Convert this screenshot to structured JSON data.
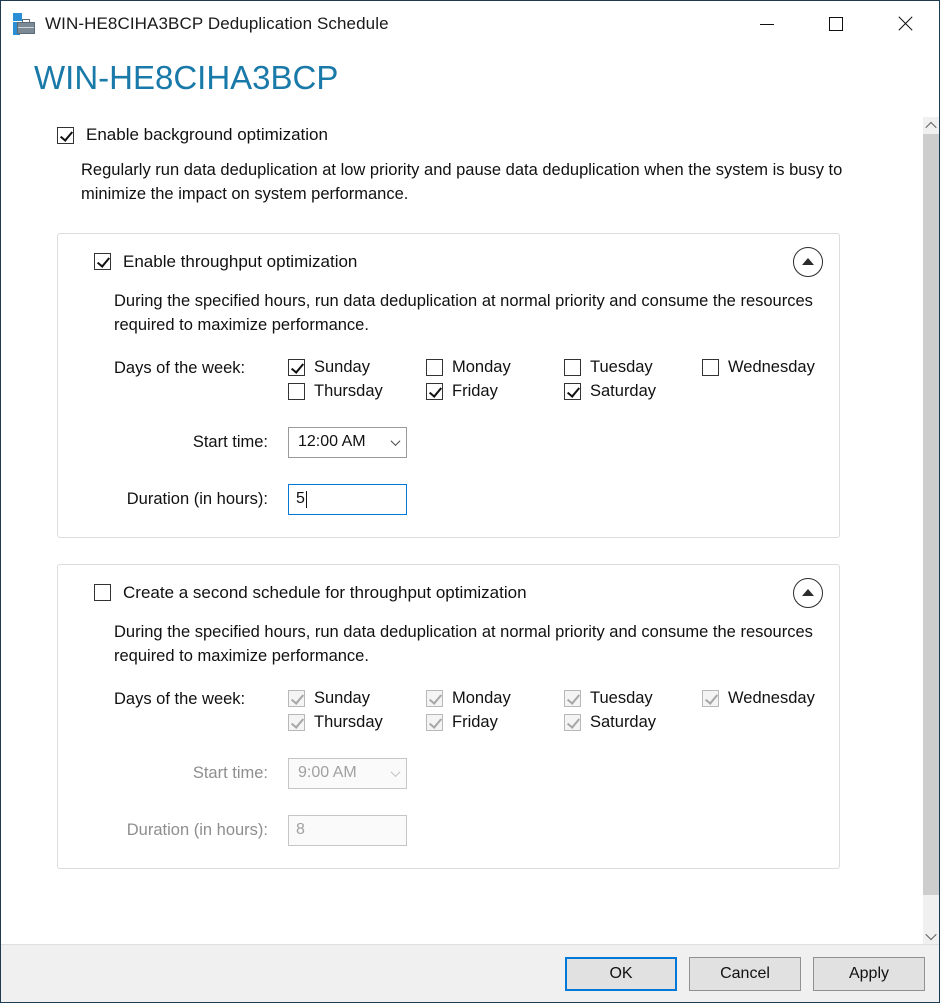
{
  "window": {
    "title": "WIN-HE8CIHA3BCP Deduplication Schedule",
    "icon": "server-volume-icon",
    "controls": {
      "minimize": "Minimize",
      "maximize": "Maximize",
      "close": "Close"
    }
  },
  "page": {
    "header": "WIN-HE8CIHA3BCP"
  },
  "background_optimization": {
    "checkbox_label": "Enable background optimization",
    "checked": true,
    "description": "Regularly run data deduplication at low priority and pause data deduplication when the system is busy to minimize the impact on system performance."
  },
  "schedule_one": {
    "checkbox_label": "Enable throughput optimization",
    "checked": true,
    "enabled": true,
    "collapse_icon": "chevron-up-icon",
    "description": "During the specified hours, run data deduplication at normal priority and consume the resources required to maximize performance.",
    "days_label": "Days of the week:",
    "days": [
      {
        "label": "Sunday",
        "checked": true
      },
      {
        "label": "Thursday",
        "checked": false
      },
      {
        "label": "Monday",
        "checked": false
      },
      {
        "label": "Friday",
        "checked": true
      },
      {
        "label": "Tuesday",
        "checked": false
      },
      {
        "label": "Saturday",
        "checked": true
      },
      {
        "label": "Wednesday",
        "checked": false
      }
    ],
    "start_time_label": "Start time:",
    "start_time_value": "12:00 AM",
    "duration_label": "Duration (in hours):",
    "duration_value": "5"
  },
  "schedule_two": {
    "checkbox_label": "Create a second schedule for throughput optimization",
    "checked": false,
    "enabled": false,
    "collapse_icon": "chevron-up-icon",
    "description": "During the specified hours, run data deduplication at normal priority and consume the resources required to maximize performance.",
    "days_label": "Days of the week:",
    "days": [
      {
        "label": "Sunday",
        "checked": true
      },
      {
        "label": "Thursday",
        "checked": true
      },
      {
        "label": "Monday",
        "checked": true
      },
      {
        "label": "Friday",
        "checked": true
      },
      {
        "label": "Tuesday",
        "checked": true
      },
      {
        "label": "Saturday",
        "checked": true
      },
      {
        "label": "Wednesday",
        "checked": true
      }
    ],
    "start_time_label": "Start time:",
    "start_time_value": "9:00 AM",
    "duration_label": "Duration (in hours):",
    "duration_value": "8"
  },
  "footer": {
    "ok_label": "OK",
    "cancel_label": "Cancel",
    "apply_label": "Apply"
  },
  "scrollbar": {
    "up_icon": "chevron-up-icon",
    "down_icon": "chevron-down-icon"
  },
  "colors": {
    "header_blue": "#1979a9",
    "accent_focus": "#0078d7",
    "footer_bg": "#f0f0f0",
    "group_border": "#dcdcdc"
  }
}
